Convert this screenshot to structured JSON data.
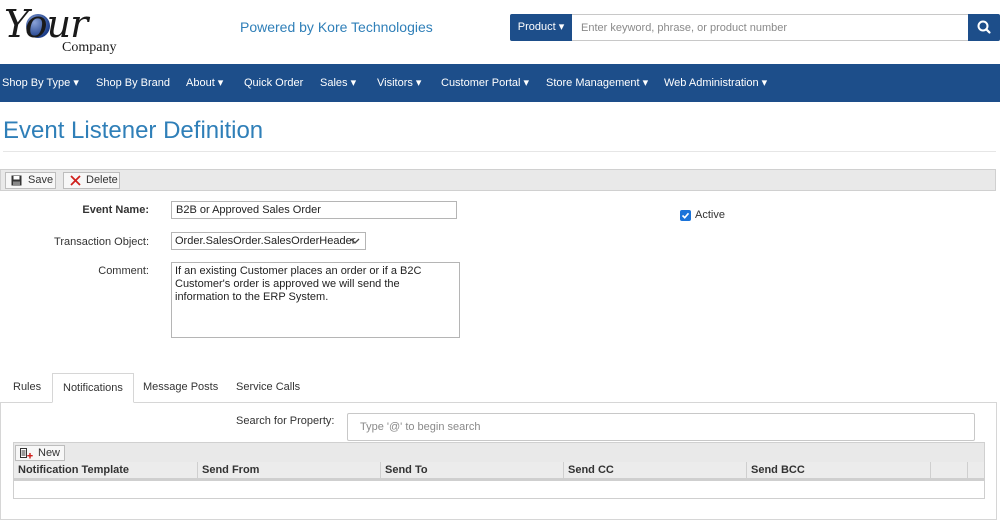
{
  "header": {
    "logo_your": "Your",
    "logo_company": "Company",
    "powered_by": "Powered by Kore Technologies",
    "product_label": "Product ▾",
    "search_placeholder": "Enter keyword, phrase, or product number"
  },
  "nav": {
    "items": [
      "Shop By Type ▾",
      "Shop By Brand",
      "About ▾",
      "Quick Order",
      "Sales ▾",
      "Visitors ▾",
      "Customer Portal ▾",
      "Store Management ▾",
      "Web Administration ▾"
    ]
  },
  "page": {
    "title": "Event Listener Definition"
  },
  "toolbar": {
    "save_label": "Save",
    "delete_label": "Delete"
  },
  "form": {
    "event_name_label": "Event Name:",
    "event_name_value": "B2B or Approved Sales Order",
    "transaction_label": "Transaction Object:",
    "transaction_value": "Order.SalesOrder.SalesOrderHeader",
    "comment_label": "Comment:",
    "comment_value": "If an existing Customer places an order or if a B2C Customer's order is approved we will send the information to the ERP System.",
    "active_label": "Active",
    "active_checked": true
  },
  "tabs": {
    "items": [
      "Rules",
      "Notifications",
      "Message Posts",
      "Service Calls"
    ],
    "active": "Notifications"
  },
  "notifications": {
    "search_label": "Search for Property:",
    "search_placeholder": "Type '@' to begin search",
    "new_label": "New",
    "columns": [
      "Notification Template",
      "Send From",
      "Send To",
      "Send CC",
      "Send BCC"
    ]
  },
  "colors": {
    "brand": "#1d4e8a",
    "title": "#2f7fb8",
    "check": "#1a73d9"
  }
}
